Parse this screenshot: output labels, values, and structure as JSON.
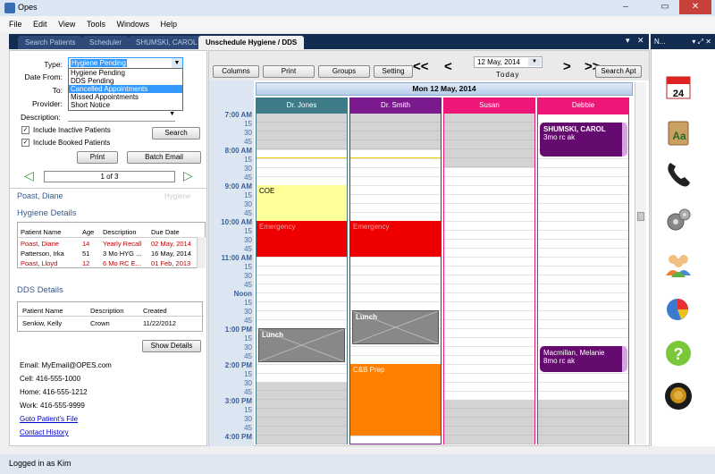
{
  "window": {
    "title": "Opes",
    "min": "–",
    "max": "▭",
    "close": "✕"
  },
  "menu": [
    "File",
    "Edit",
    "View",
    "Tools",
    "Windows",
    "Help"
  ],
  "doc_tabs": [
    "Search Patients",
    "Scheduler",
    "SHUMSKI, CAROL",
    "Unschedule Hygiene / DDS"
  ],
  "doc_controls": {
    "dropdown": "▾",
    "close": "✕"
  },
  "form": {
    "type_label": "Type:",
    "type_value": "Hygiene Pending",
    "type_options": [
      "Hygiene Pending",
      "DDS Pending",
      "Cancelled Appointments",
      "Missed Appointments",
      "Short Notice"
    ],
    "type_selected_index": 2,
    "date_from_label": "Date From:",
    "to_label": "To:",
    "provider_label": "Provider:",
    "description_label": "Description:",
    "include_inactive": {
      "label": "Include Inactive Patients",
      "checked": true
    },
    "include_booked": {
      "label": "Include Booked Patients",
      "checked": true
    },
    "search_button": "Search",
    "print_button": "Print",
    "batch_email_button": "Batch Email",
    "pager": "1 of 3",
    "prev": "◁",
    "next": "▷"
  },
  "patient_name": "Poast, Diane",
  "patient_tag": "Hygiene",
  "hygiene": {
    "title": "Hygiene Details",
    "headers": [
      "Patient Name",
      "Age",
      "Description",
      "Due Date"
    ],
    "rows": [
      {
        "name": "Poast, Diane",
        "age": "14",
        "desc": "Yearly Recall",
        "due": "02 May, 2014",
        "red": true
      },
      {
        "name": "Patterson, Irka",
        "age": "51",
        "desc": "3 Mo HYG ...",
        "due": "16 May, 2014",
        "red": false
      },
      {
        "name": "Poast, Lloyd",
        "age": "12",
        "desc": "6 Mo RC E...",
        "due": "01 Feb, 2013",
        "red": true
      }
    ]
  },
  "dds": {
    "title": "DDS Details",
    "headers": [
      "Patient Name",
      "Description",
      "Created"
    ],
    "rows": [
      {
        "name": "Senkiw, Kelly",
        "desc": "Crown",
        "created": "11/22/2012"
      }
    ]
  },
  "show_details_button": "Show Details",
  "contact": {
    "email": "Email: MyEmail@OPES.com",
    "cell": "Cell: 416-555-1000",
    "home": "Home: 416-555-1212",
    "work": "Work: 416-555-9999",
    "goto_file": "Goto Patient's File",
    "contact_history": "Contact History"
  },
  "scheduler": {
    "columns_btn": "Columns",
    "print_btn": "Print",
    "groups_btn": "Groups",
    "settings_btn": "Setting",
    "nav_first": "<<",
    "nav_prev": "<",
    "nav_next": ">",
    "nav_last": ">>",
    "date_value": "12 May, 2014",
    "today": "Today",
    "search_appt": "Search Apt",
    "day_header": "Mon 12 May, 2014",
    "providers": [
      {
        "name": "Dr. Jones",
        "color": "#3d7b86"
      },
      {
        "name": "Dr. Smith",
        "color": "#7b1a8e"
      },
      {
        "name": "Susan",
        "color": "#ee1677"
      },
      {
        "name": "Debbie",
        "color": "#ee1677"
      }
    ],
    "times": [
      "7:00 AM",
      "15",
      "30",
      "45",
      "8:00 AM",
      "15",
      "30",
      "45",
      "9:00 AM",
      "15",
      "30",
      "45",
      "10:00 AM",
      "15",
      "30",
      "45",
      "11:00 AM",
      "15",
      "30",
      "45",
      "Noon",
      "15",
      "30",
      "45",
      "1:00 PM",
      "15",
      "30",
      "45",
      "2:00 PM",
      "15",
      "30",
      "45",
      "3:00 PM",
      "15",
      "30",
      "45",
      "4:00 PM"
    ],
    "appointments": {
      "coe": "COE",
      "emergency1": "Emergency",
      "emergency2": "Emergency",
      "lunch1": "Lunch",
      "lunch2": "Lunch",
      "cb_prep": "C&B Prep",
      "shumski_name": "SHUMSKI, CAROL",
      "shumski_note": "3mo rc ak",
      "macmillan_name": "Macmillan, Melanie",
      "macmillan_note": "8mo rc ak"
    }
  },
  "right_panel": {
    "title": "N...",
    "controls": "▾ ⤢ ✕"
  },
  "status": "Logged in as Kim"
}
